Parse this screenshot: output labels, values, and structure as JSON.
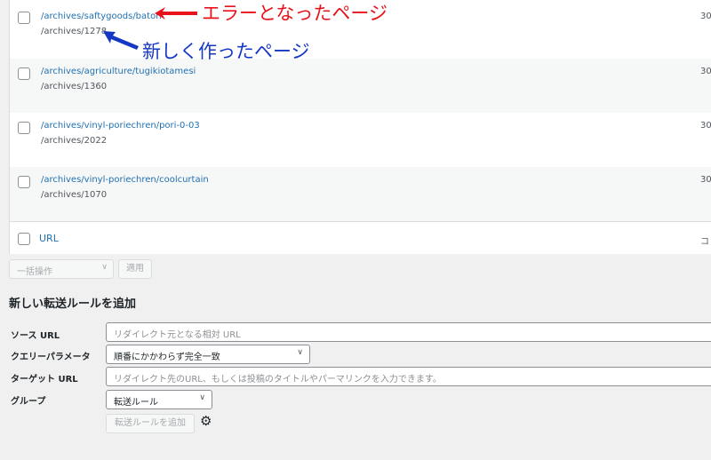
{
  "annotations": {
    "error_page": "エラーとなったページ",
    "new_page": "新しく作ったページ",
    "red": "#e8131a",
    "blue": "#1538c4"
  },
  "redirects": [
    {
      "source": "/archives/saftygoods/baton",
      "target": "/archives/1278",
      "code": "30"
    },
    {
      "source": "/archives/agriculture/tugikiotamesi",
      "target": "/archives/1360",
      "code": "30"
    },
    {
      "source": "/archives/vinyl-poriechren/pori-0-03",
      "target": "/archives/2022",
      "code": "30"
    },
    {
      "source": "/archives/vinyl-poriechren/coolcurtain",
      "target": "/archives/1070",
      "code": "30"
    }
  ],
  "table_footer": {
    "url_label": "URL",
    "code_label": "コ"
  },
  "bulk": {
    "label": "一括操作",
    "apply": "適用"
  },
  "add_rule": {
    "title": "新しい転送ルールを追加",
    "source_label": "ソース URL",
    "source_placeholder": "リダイレクト元となる相対 URL",
    "query_label": "クエリーパラメータ",
    "query_value": "順番にかかわらず完全一致",
    "target_label": "ターゲット URL",
    "target_placeholder": "リダイレクト先のURL、もしくは投稿のタイトルやパーマリンクを入力できます。",
    "group_label": "グループ",
    "group_value": "転送ルール",
    "add_button": "転送ルールを追加"
  }
}
